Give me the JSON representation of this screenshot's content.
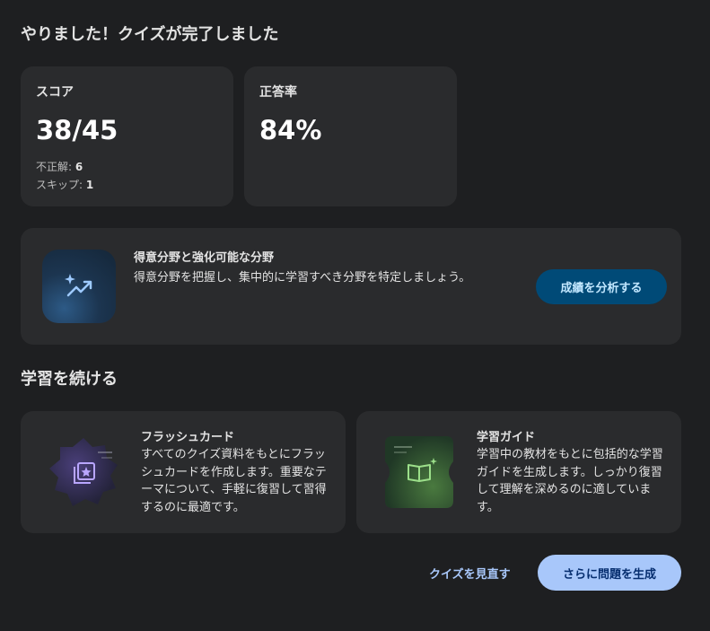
{
  "header": {
    "title": "やりました！クイズが完了しました"
  },
  "score_card": {
    "label": "スコア",
    "value": "38/45",
    "incorrect_label": "不正解: ",
    "incorrect_value": "6",
    "skipped_label": "スキップ: ",
    "skipped_value": "1"
  },
  "accuracy_card": {
    "label": "正答率",
    "value": "84%"
  },
  "analysis": {
    "title": "得意分野と強化可能な分野",
    "description": "得意分野を把握し、集中的に学習すべき分野を特定しましょう。",
    "button_label": "成績を分析する",
    "icon": "sparkle-trending-up-icon"
  },
  "continue_section": {
    "title": "学習を続ける",
    "cards": [
      {
        "title": "フラッシュカード",
        "description": "すべてのクイズ資料をもとにフラッシュカードを作成します。重要なテーマについて、手軽に復習して習得するのに最適です。",
        "icon": "flashcards-icon"
      },
      {
        "title": "学習ガイド",
        "description": "学習中の教材をもとに包括的な学習ガイドを生成します。しっかり復習して理解を深めるのに適しています。",
        "icon": "study-guide-book-icon"
      }
    ]
  },
  "footer": {
    "review_label": "クイズを見直す",
    "generate_more_label": "さらに問題を生成"
  },
  "colors": {
    "background": "#1e1f21",
    "card": "#2a2b2d",
    "primary_button": "#a8c7fa",
    "analyze_button": "#004a77"
  }
}
